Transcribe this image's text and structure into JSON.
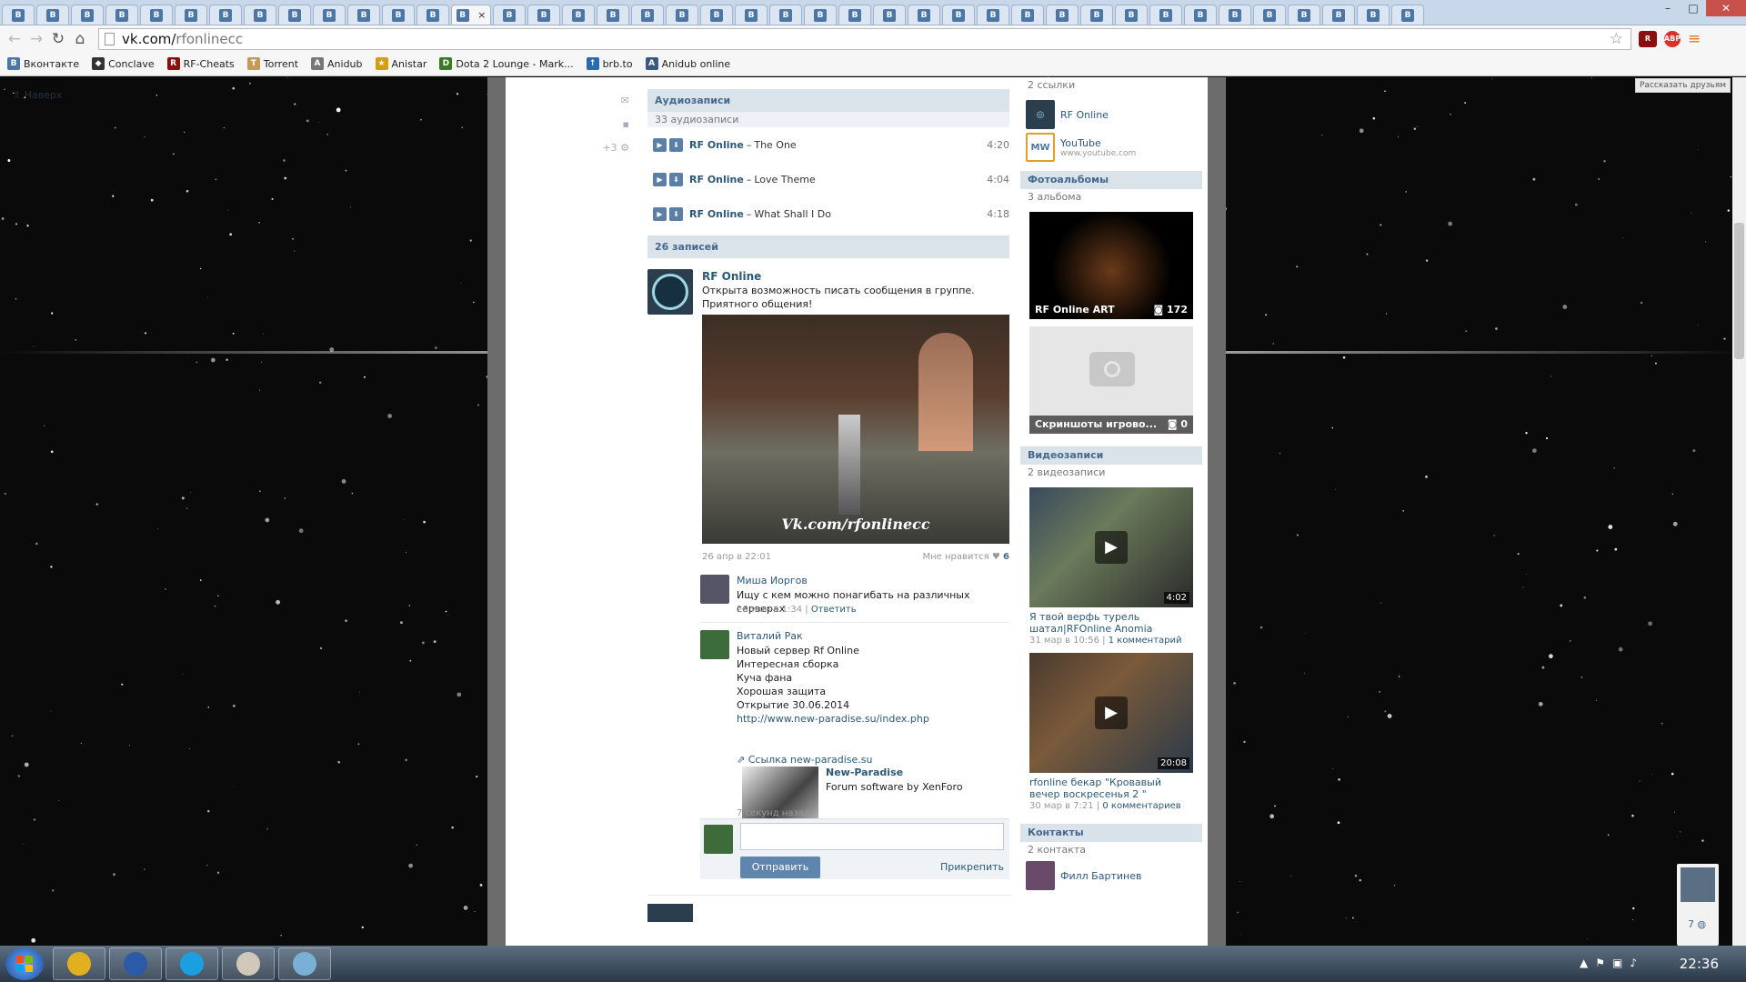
{
  "browser": {
    "tab_count": 41,
    "active_tab_index": 13,
    "tab_close": "×",
    "url_host": "vk.com/",
    "url_path": "rfonlinecc",
    "abp_label": "ABP",
    "window_buttons": [
      "–",
      "□",
      "✕"
    ]
  },
  "bookmarks": [
    {
      "label": "Вконтакте",
      "icon": "vk-icon",
      "color": "#4a76a8",
      "glyph": "B"
    },
    {
      "label": "Conclave",
      "icon": "shield-icon",
      "color": "#333333",
      "glyph": "◆"
    },
    {
      "label": "RF-Cheats",
      "icon": "rf-icon",
      "color": "#8a1010",
      "glyph": "R"
    },
    {
      "label": "Torrent",
      "icon": "torrent-icon",
      "color": "#c49a5a",
      "glyph": "T"
    },
    {
      "label": "Anidub",
      "icon": "anidub-icon",
      "color": "#777777",
      "glyph": "A"
    },
    {
      "label": "Anistar",
      "icon": "star-icon",
      "color": "#d4a000",
      "glyph": "★"
    },
    {
      "label": "Dota 2 Lounge - Mark...",
      "icon": "dota-icon",
      "color": "#3a7a20",
      "glyph": "D"
    },
    {
      "label": "brb.to",
      "icon": "arrow-up-icon",
      "color": "#2a6ab0",
      "glyph": "↑"
    },
    {
      "label": "Anidub online",
      "icon": "anidub-online-icon",
      "color": "#3a5a80",
      "glyph": "A"
    }
  ],
  "page": {
    "up_link": "Наверх",
    "side_counter": "+3",
    "tooltip": "Рассказать друзьям"
  },
  "audio": {
    "header": "Аудиозаписи",
    "count": "33 аудиозаписи",
    "tracks": [
      {
        "artist": "RF Online",
        "title": "The One",
        "duration": "4:20"
      },
      {
        "artist": "RF Online",
        "title": "Love Theme",
        "duration": "4:04"
      },
      {
        "artist": "RF Online",
        "title": "What Shall I Do",
        "duration": "4:18"
      }
    ]
  },
  "wall": {
    "header": "26 записей",
    "post": {
      "author": "RF Online",
      "text": "Открыта возможность писать сообщения в группе. Приятного общения!",
      "image_watermark": "Vk.com/rfonlinecc",
      "date": "26 апр в 22:01",
      "likes_label": "Мне нравится",
      "likes_count": "6"
    },
    "comments": [
      {
        "author": "Миша Иоргов",
        "text": "Ищу с кем можно понагибать на различных серверах",
        "date": "26 июн в 1:34",
        "reply": "Ответить"
      },
      {
        "author": "Виталий Рак",
        "lines": [
          "Новый сервер Rf Online",
          "Интересная сборка",
          "Куча фана",
          "Хорошая защита",
          "Открытие 30.06.2014"
        ],
        "url": "http://www.new-paradise.su/index.php",
        "link_label": "Ссылка new-paradise.su",
        "link_title": "New-Paradise",
        "link_desc": "Forum software by XenForo",
        "date": "7 секунд назад"
      }
    ],
    "composer": {
      "send": "Отправить",
      "attach": "Прикрепить"
    }
  },
  "links": {
    "count": "2 ссылки",
    "items": [
      {
        "name": "RF Online",
        "url": ""
      },
      {
        "name": "YouTube",
        "url": "www.youtube.com"
      }
    ]
  },
  "albums": {
    "header": "Фотоальбомы",
    "count": "3 альбома",
    "items": [
      {
        "title": "RF Online ART",
        "count": "172"
      },
      {
        "title": "Скриншоты игрово...",
        "count": "0"
      }
    ]
  },
  "videos": {
    "header": "Видеозаписи",
    "count": "2 видеозаписи",
    "items": [
      {
        "duration": "4:02",
        "title": "Я твой верфь турель шатал|RFOnline Anomia",
        "date": "31 мар в 10:56",
        "comments": "1 комментарий"
      },
      {
        "duration": "20:08",
        "title": "rfonline бекар \"Кровавый вечер воскресенья 2 \"",
        "date": "30 мар в 7:21",
        "comments": "0 комментариев"
      }
    ]
  },
  "contacts": {
    "header": "Контакты",
    "count": "2 контакта",
    "items": [
      {
        "name": "Филл Бартинев"
      }
    ]
  },
  "right_widget": {
    "count": "7"
  },
  "taskbar": {
    "clock": "22:36",
    "apps": [
      {
        "name": "chrome-icon",
        "color": "#e0b020"
      },
      {
        "name": "save-icon",
        "color": "#2a5aa8"
      },
      {
        "name": "skype-icon",
        "color": "#1aa0e0"
      },
      {
        "name": "paint-icon",
        "color": "#d0c8b8"
      },
      {
        "name": "notepad-icon",
        "color": "#7ab0d8"
      }
    ]
  },
  "colors": {
    "vk_blue": "#4a76a8",
    "vk_header": "#dae2ea",
    "vk_link": "#2b587a"
  }
}
